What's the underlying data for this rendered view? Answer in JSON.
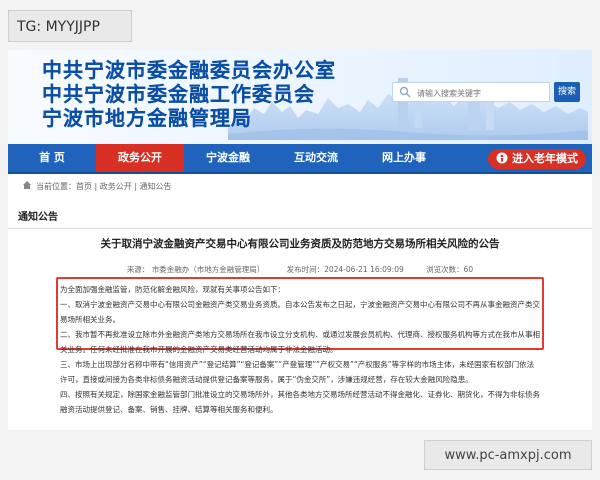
{
  "tag_label": "TG: MYYJJPP",
  "watermark": "www.pc-amxpj.com",
  "site": {
    "title_lines": [
      "中共宁波市委金融委员会办公室",
      "中共宁波市委金融工作委员会",
      "宁波市地方金融管理局"
    ],
    "search_placeholder": "请输入搜索关键字",
    "search_button": "搜索"
  },
  "nav": [
    {
      "label": "首 页",
      "active": false
    },
    {
      "label": "政务公开",
      "active": true
    },
    {
      "label": "宁波金融",
      "active": false
    },
    {
      "label": "互动交流",
      "active": false
    },
    {
      "label": "网上办事",
      "active": false
    }
  ],
  "elder_mode": "进入老年模式",
  "breadcrumb": {
    "prefix": "当前位置：",
    "path": "首页 | 政务公开 | 通知公告"
  },
  "section_label": "通知公告",
  "article": {
    "title": "关于取消宁波金融资产交易中心有限公司业务资质及防范地方交易场所相关风险的公告",
    "source": "来源： 市委金融办（市地方金融管理局）",
    "date": "发布时间：2024-06-21 16:09:09",
    "views": "浏览次数：60",
    "paragraphs": [
      "为全面加强金融监管，防范化解金融风险，现就有关事项公告如下：",
      "一、取消宁波金融资产交易中心有限公司金融资产类交易业务资质。自本公告发布之日起，宁波金融资产交易中心有限公司不再从事金融资产类交易场所相关业务。",
      "二、我市暂不再批准设立除市外金融资产类地方交易场所在我市设立分支机构、或通过发展会员机构、代理商、授权服务机构等方式在我市从事相关业务。任何未经批准在我市开展的金融资产交易类经营活动均属于非法金融活动。",
      "三、市场上出现部分名称中带有“信用资产”“登记结算”“登记备案”“产登管理”“产权交易”“产权服务”等字样的市场主体，未经国家有权部门依法许可，直接或间接为各类非标债务融资活动提供登记备案等服务，属于“伪金交所”，涉嫌违规经营，存在较大金融风险隐患。",
      "四、按照有关规定，除国家金融监管部门批准设立的交易场所外，其他各类地方交易场所经营活动不得金融化、证券化、期货化，不得为非标债务融资活动提供登记、备案、销售、挂牌、结算等相关服务和便利。"
    ]
  }
}
